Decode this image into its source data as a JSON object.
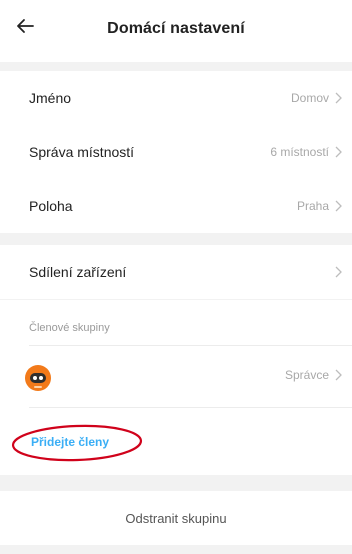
{
  "header": {
    "title": "Domácí nastavení",
    "back_icon": "arrow-left-icon"
  },
  "settings": {
    "rows": [
      {
        "label": "Jméno",
        "value": "Domov"
      },
      {
        "label": "Správa místností",
        "value": "6 místností"
      },
      {
        "label": "Poloha",
        "value": "Praha"
      }
    ]
  },
  "sharing": {
    "label": "Sdílení zařízení"
  },
  "members": {
    "caption": "Členové skupiny",
    "member_role": "Správce",
    "add_label": "Přidejte členy",
    "accent_color": "#3aaef5"
  },
  "footer": {
    "delete_label": "Odstranit skupinu"
  },
  "annotation": {
    "color": "#d0021b",
    "shape": "ellipse"
  }
}
